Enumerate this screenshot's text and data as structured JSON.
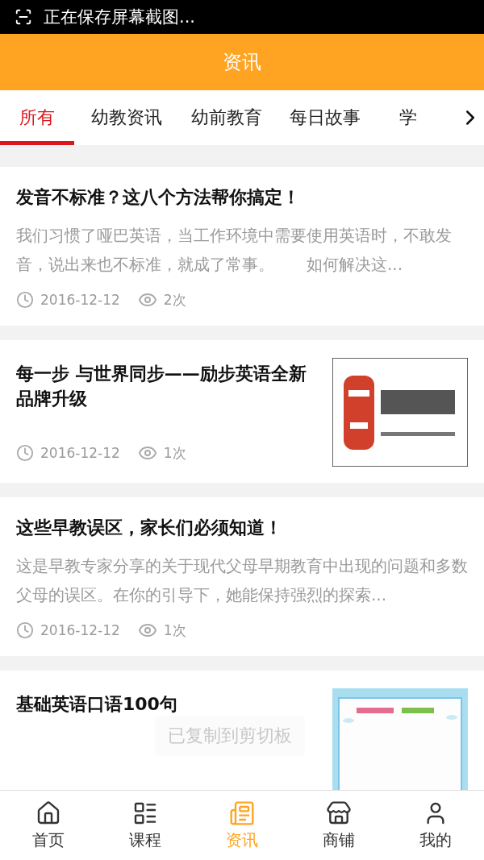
{
  "status_bar": {
    "text": "正在保存屏幕截图..."
  },
  "header": {
    "title": "资讯"
  },
  "tabs": [
    {
      "label": "所有",
      "selected": true
    },
    {
      "label": "幼教资讯",
      "selected": false
    },
    {
      "label": "幼前教育",
      "selected": false
    },
    {
      "label": "每日故事",
      "selected": false
    },
    {
      "label": "学",
      "selected": false
    }
  ],
  "articles": [
    {
      "kind": "text",
      "title": "发音不标准？这八个方法帮你搞定！",
      "summary": "我们习惯了哑巴英语，当工作环境中需要使用英语时，不敢发音，说出来也不标准，就成了常事。　　如何解决这...",
      "date": "2016-12-12",
      "views": "2次"
    },
    {
      "kind": "thumb",
      "title": "每一步 与世界同步——励步英语全新品牌升级",
      "date": "2016-12-12",
      "views": "1次"
    },
    {
      "kind": "text",
      "title": "这些早教误区，家长们必须知道！",
      "summary": "这是早教专家分享的关于现代父母早期教育中出现的问题和多数父母的误区。在你的引导下，她能保持强烈的探索...",
      "date": "2016-12-12",
      "views": "1次"
    },
    {
      "kind": "thumb",
      "title": "基础英语口语100句"
    }
  ],
  "toast": {
    "text": "已复制到剪切板"
  },
  "bottom_nav": [
    {
      "label": "首页",
      "selected": false
    },
    {
      "label": "课程",
      "selected": false
    },
    {
      "label": "资讯",
      "selected": true
    },
    {
      "label": "商铺",
      "selected": false
    },
    {
      "label": "我的",
      "selected": false
    }
  ]
}
